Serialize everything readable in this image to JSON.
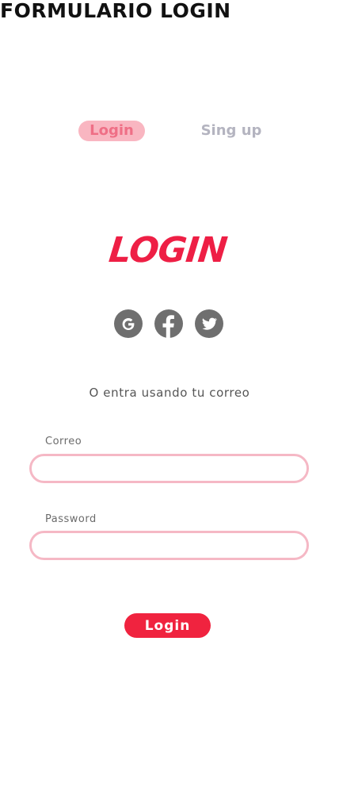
{
  "page": {
    "title": "FORMULARIO LOGIN"
  },
  "tabs": {
    "login_label": "Login",
    "signup_label": "Sing up"
  },
  "logo": {
    "text": "LOGIN",
    "color": "#ee1f45"
  },
  "social": {
    "icons": [
      "google-icon",
      "facebook-icon",
      "twitter-icon"
    ],
    "color": "#6f6f6f"
  },
  "form": {
    "alt_text": "O entra usando tu correo",
    "email_label": "Correo",
    "email_value": "",
    "password_label": "Password",
    "password_value": "",
    "submit_label": "Login",
    "field_border_color": "#f5b8c5",
    "submit_color": "#f0233f"
  }
}
